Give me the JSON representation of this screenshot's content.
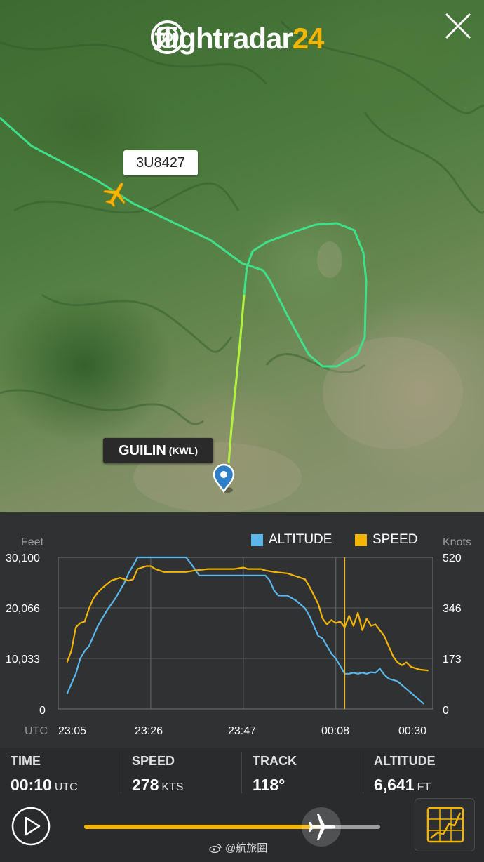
{
  "app": {
    "logo_prefix": "flightradar",
    "logo_suffix": "24",
    "close_icon": "close-x-icon"
  },
  "map": {
    "flight_callsign": "3U8427",
    "airport_name": "GUILIN",
    "airport_code": "(KWL)",
    "route_color": "#3fe08a",
    "plane_icon": "airplane-icon",
    "pin_icon": "map-pin-icon"
  },
  "graph": {
    "legend": {
      "altitude": "ALTITUDE",
      "speed": "SPEED",
      "altitude_color": "#5bb6ea",
      "speed_color": "#f4b500"
    },
    "left_unit": "Feet",
    "right_unit": "Knots",
    "x_axis_label": "UTC",
    "left_ticks": [
      "30,100",
      "20,066",
      "10,033",
      "0"
    ],
    "right_ticks": [
      "520",
      "346",
      "173",
      "0"
    ],
    "x_ticks": [
      "23:05",
      "23:26",
      "23:47",
      "00:08",
      "00:30"
    ]
  },
  "chart_data": {
    "type": "line",
    "x_label": "UTC",
    "x_ticks": [
      "23:05",
      "23:26",
      "23:47",
      "00:08",
      "00:30"
    ],
    "x_range_minutes": [
      0,
      85
    ],
    "cursor_minute": 65,
    "series": [
      {
        "name": "ALTITUDE",
        "axis": "left",
        "unit": "Feet",
        "ylim": [
          0,
          30100
        ],
        "points": [
          [
            2,
            3000
          ],
          [
            3,
            5000
          ],
          [
            4,
            7000
          ],
          [
            5,
            10000
          ],
          [
            6,
            11500
          ],
          [
            7,
            12500
          ],
          [
            9,
            16500
          ],
          [
            11,
            19500
          ],
          [
            13,
            22000
          ],
          [
            15,
            25000
          ],
          [
            16,
            27000
          ],
          [
            17,
            28500
          ],
          [
            18,
            30100
          ],
          [
            21,
            30100
          ],
          [
            27,
            30100
          ],
          [
            29,
            30100
          ],
          [
            30,
            29000
          ],
          [
            32,
            26500
          ],
          [
            40,
            26500
          ],
          [
            42,
            26500
          ],
          [
            44,
            26500
          ],
          [
            47,
            26500
          ],
          [
            48,
            25500
          ],
          [
            49,
            23500
          ],
          [
            50,
            22500
          ],
          [
            52,
            22500
          ],
          [
            54,
            21500
          ],
          [
            56,
            20000
          ],
          [
            57,
            18500
          ],
          [
            58,
            16500
          ],
          [
            59,
            14500
          ],
          [
            60,
            14000
          ],
          [
            61,
            12500
          ],
          [
            62,
            11000
          ],
          [
            63,
            10000
          ],
          [
            64,
            8500
          ],
          [
            65,
            7000
          ],
          [
            66,
            7000
          ],
          [
            67,
            7200
          ],
          [
            68,
            7000
          ],
          [
            69,
            7200
          ],
          [
            70,
            7000
          ],
          [
            71,
            7300
          ],
          [
            72,
            7200
          ],
          [
            73,
            8000
          ],
          [
            74,
            6800
          ],
          [
            75,
            6000
          ],
          [
            77,
            5500
          ],
          [
            79,
            4000
          ],
          [
            81,
            2500
          ],
          [
            83,
            1000
          ]
        ]
      },
      {
        "name": "SPEED",
        "axis": "right",
        "unit": "Knots",
        "ylim": [
          0,
          520
        ],
        "points": [
          [
            2,
            160
          ],
          [
            3,
            200
          ],
          [
            4,
            280
          ],
          [
            5,
            295
          ],
          [
            6,
            300
          ],
          [
            7,
            345
          ],
          [
            8,
            380
          ],
          [
            9,
            400
          ],
          [
            10,
            415
          ],
          [
            12,
            440
          ],
          [
            14,
            450
          ],
          [
            16,
            440
          ],
          [
            17,
            445
          ],
          [
            18,
            480
          ],
          [
            20,
            490
          ],
          [
            21,
            490
          ],
          [
            22,
            480
          ],
          [
            24,
            470
          ],
          [
            29,
            470
          ],
          [
            31,
            475
          ],
          [
            34,
            480
          ],
          [
            40,
            480
          ],
          [
            42,
            485
          ],
          [
            43,
            480
          ],
          [
            46,
            480
          ],
          [
            47,
            475
          ],
          [
            49,
            470
          ],
          [
            52,
            465
          ],
          [
            54,
            455
          ],
          [
            56,
            445
          ],
          [
            57,
            420
          ],
          [
            58,
            390
          ],
          [
            59,
            360
          ],
          [
            60,
            310
          ],
          [
            61,
            290
          ],
          [
            62,
            305
          ],
          [
            63,
            295
          ],
          [
            64,
            300
          ],
          [
            65,
            280
          ],
          [
            66,
            320
          ],
          [
            67,
            285
          ],
          [
            68,
            330
          ],
          [
            69,
            270
          ],
          [
            70,
            310
          ],
          [
            71,
            285
          ],
          [
            72,
            290
          ],
          [
            73,
            270
          ],
          [
            74,
            250
          ],
          [
            75,
            215
          ],
          [
            76,
            180
          ],
          [
            77,
            160
          ],
          [
            78,
            150
          ],
          [
            79,
            160
          ],
          [
            80,
            145
          ],
          [
            82,
            135
          ],
          [
            84,
            132
          ]
        ]
      }
    ]
  },
  "stats": {
    "time_label": "TIME",
    "time_value": "00:10",
    "time_unit": "UTC",
    "speed_label": "SPEED",
    "speed_value": "278",
    "speed_unit": "KTS",
    "track_label": "TRACK",
    "track_value": "118°",
    "altitude_label": "ALTITUDE",
    "altitude_value": "6,641",
    "altitude_unit": "FT"
  },
  "controls": {
    "play_icon": "play-icon",
    "map_view_icon": "map-grid-icon",
    "playback_progress": 0.8
  },
  "watermark": {
    "text": "@航旅圈"
  }
}
